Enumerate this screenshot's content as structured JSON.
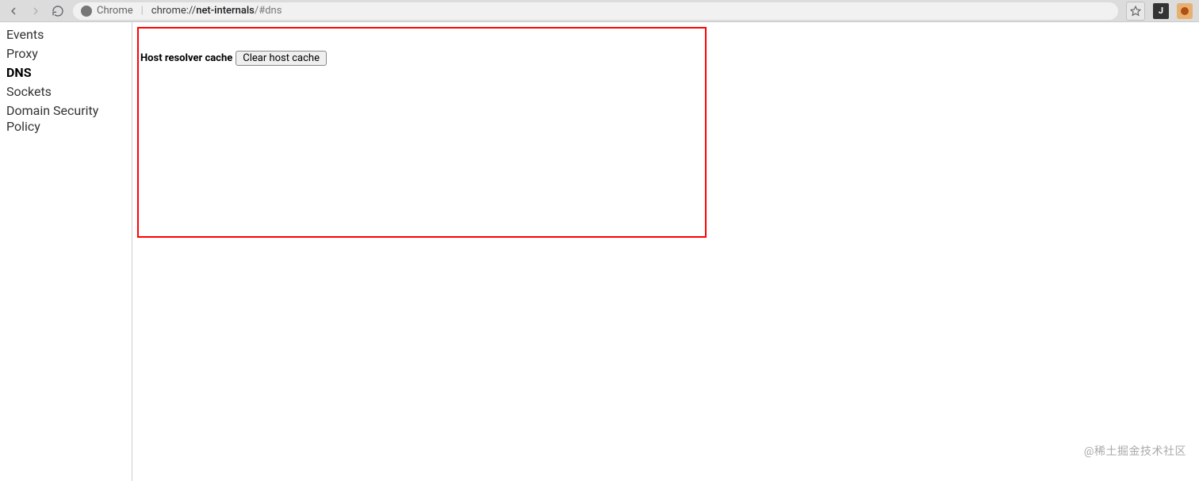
{
  "browser": {
    "origin_label": "Chrome",
    "url_host": "chrome://",
    "url_path_strong": "net-internals",
    "url_hash": "/#dns",
    "extension_badge": "J"
  },
  "sidebar": {
    "items": [
      {
        "label": "Events",
        "active": false
      },
      {
        "label": "Proxy",
        "active": false
      },
      {
        "label": "DNS",
        "active": true
      },
      {
        "label": "Sockets",
        "active": false
      },
      {
        "label": "Domain Security Policy",
        "active": false
      }
    ]
  },
  "content": {
    "resolver_label": "Host resolver cache",
    "clear_button_label": "Clear host cache"
  },
  "watermark": "@稀土掘金技术社区"
}
